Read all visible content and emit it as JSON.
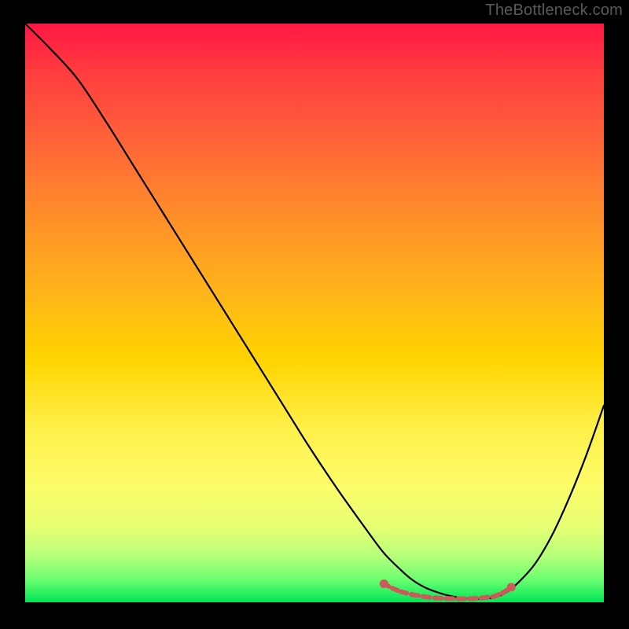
{
  "watermark": "TheBottleneck.com",
  "colors": {
    "page_bg": "#000000",
    "curve": "#000000",
    "highlight": "#cc5a5a",
    "watermark": "#5a5a5a"
  },
  "chart_data": {
    "type": "line",
    "title": "",
    "xlabel": "",
    "ylabel": "",
    "xlim": [
      0,
      100
    ],
    "ylim": [
      0,
      100
    ],
    "series": [
      {
        "name": "bottleneck_curve",
        "x": [
          0,
          4,
          9,
          14,
          19,
          24,
          29,
          34,
          39,
          44,
          49,
          54,
          59,
          62,
          65,
          67,
          69,
          71,
          73,
          75,
          77,
          79,
          81,
          83,
          85,
          88,
          91,
          94,
          97,
          100
        ],
        "y": [
          100,
          96,
          90.5,
          83,
          75,
          67,
          59,
          51,
          43,
          35,
          27,
          19.5,
          12.5,
          8.5,
          5.5,
          3.8,
          2.6,
          1.8,
          1.2,
          0.8,
          0.6,
          0.6,
          0.8,
          1.6,
          3.2,
          6.5,
          11.5,
          18,
          25.5,
          34
        ]
      },
      {
        "name": "highlight_band",
        "points": [
          {
            "x": 62,
            "y": 3.2
          },
          {
            "x": 63.5,
            "y": 2.4
          },
          {
            "x": 65,
            "y": 1.8
          },
          {
            "x": 67,
            "y": 1.3
          },
          {
            "x": 69,
            "y": 0.95
          },
          {
            "x": 71,
            "y": 0.75
          },
          {
            "x": 73,
            "y": 0.65
          },
          {
            "x": 75,
            "y": 0.6
          },
          {
            "x": 77,
            "y": 0.62
          },
          {
            "x": 79,
            "y": 0.75
          },
          {
            "x": 81,
            "y": 1.0
          },
          {
            "x": 82.5,
            "y": 1.6
          },
          {
            "x": 84,
            "y": 2.6
          }
        ]
      }
    ]
  }
}
